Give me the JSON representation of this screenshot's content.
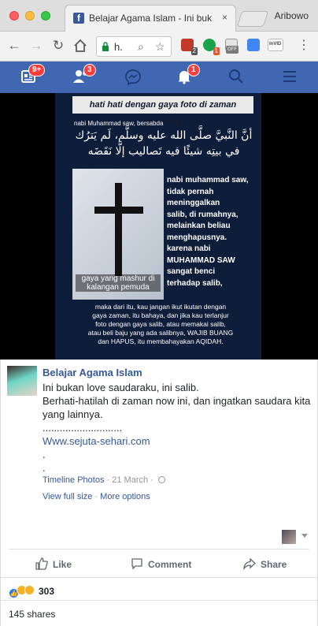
{
  "browser": {
    "tab_title": "Belajar Agama Islam - Ini buk",
    "tab_close": "×",
    "profile_name": "Aribowo",
    "url_text": "h.",
    "extensions": [
      {
        "name": "ublock-icon",
        "badge": "2",
        "color": "#c0392b"
      },
      {
        "name": "grammar-icon",
        "badge": "1",
        "color": "#16a34a"
      },
      {
        "name": "offline-icon",
        "badge": "OFF",
        "color": "#7a7a7a"
      },
      {
        "name": "translate-icon",
        "badge": "",
        "color": "#4285f4"
      },
      {
        "name": "invid-icon",
        "badge": "InVID",
        "color": "#6b7280"
      }
    ]
  },
  "fb_nav": {
    "feed_badge": "9+",
    "friends_badge": "3",
    "notifications_badge": "1",
    "bar_color": "#4267b2"
  },
  "photo": {
    "header": "hati hati dengan gaya foto di zaman sekarang",
    "subheader": "nabi Muhammad saw, bersabda",
    "arabic_line1": "أنَّ النَّبيَّ صلَّى الله عليه وسلَّم، لَم يَترُك",
    "arabic_line2": "في بيتِه شيئًا فيه تَصاليب إلَّا نَقَضَه",
    "image_caption": "gaya yang mashur di kalangan pemuda",
    "right_text": [
      "nabi muhammad saw,",
      "tidak pernah",
      "meninggalkan",
      "salib, di rumahnya,",
      "melainkan beliau",
      "menghapusnya.",
      "karena nabi",
      "MUHAMMAD SAW",
      "sangat benci",
      "terhadap salib,"
    ],
    "bottom_text": [
      "maka dari itu, kau jangan ikut ikutan dengan",
      "gaya zaman, itu bahaya, dan jika kau terlanjur",
      "foto dengan gaya salib, atau memakai salib,",
      "atau beli baju yang ada salibnya, WAJIB BUANG",
      "dan HAPUS, itu membahayakan AQIDAH."
    ]
  },
  "post": {
    "author": "Belajar Agama Islam",
    "lines": [
      "Ini bukan love saudaraku, ini salib.",
      "Berhati-hatilah di zaman now ini, dan ingatkan saudara kita",
      "yang lainnya.",
      "............................"
    ],
    "link": "Www.sejuta-sehari.com",
    "dots": [
      ".",
      "."
    ],
    "album": "Timeline Photos",
    "date": "21 March",
    "sep": " · ",
    "view_full_size": "View full size",
    "more_options": "More options",
    "like_label": "Like",
    "comment_label": "Comment",
    "share_label": "Share",
    "reaction_count": "303",
    "shares_text": "145 shares"
  }
}
